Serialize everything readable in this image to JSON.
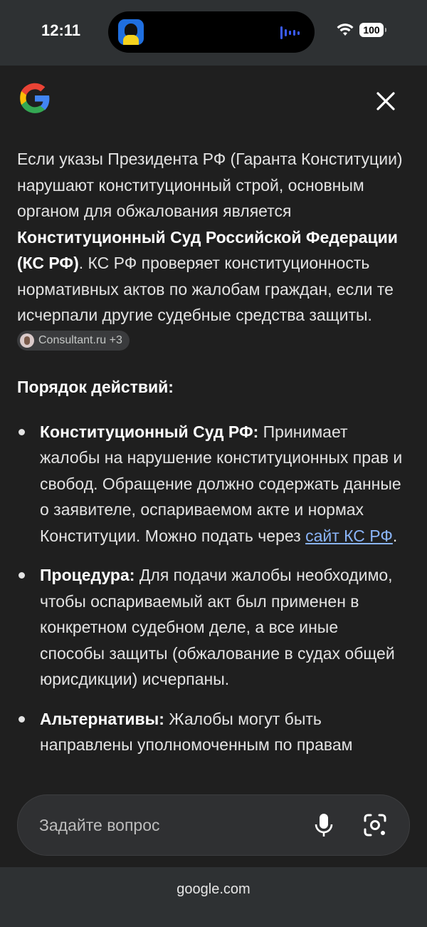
{
  "status_bar": {
    "time": "12:11",
    "battery": "100",
    "icons": [
      "app-icon",
      "audio-wave-icon",
      "wifi-icon",
      "battery-icon"
    ]
  },
  "panel": {
    "logo": "google-g-icon",
    "close_icon": "close-icon",
    "intro": {
      "part1": "Если указы Президента РФ (Гаранта Конституции) нарушают конституционный строй, основным органом для обжалования является ",
      "bold": "Конституционный Суд Российской Федерации (КС РФ)",
      "part2": ". КС РФ проверяет конституционность нормативных актов по жалобам граждан, если те исчерпали другие судебные средства защиты.",
      "source_chip": "Consultant.ru +3"
    },
    "heading": "Порядок действий:",
    "bullets": [
      {
        "title": "Конституционный Суд РФ:",
        "text": " Принимает жалобы на нарушение конституционных прав и свобод. Обращение должно содержать данные о заявителе, оспариваемом акте и нормах Конституции. Можно подать через ",
        "link": "сайт КС РФ",
        "end": "."
      },
      {
        "title": "Процедура:",
        "text": " Для подачи жалобы необходимо, чтобы оспариваемый акт был применен в конкретном судебном деле, а все иные способы защиты (обжалование в судах общей юрисдикции) исчерпаны."
      },
      {
        "title": "Альтернативы:",
        "text": " Жалобы могут быть направлены уполномоченным по правам"
      }
    ]
  },
  "ask_bar": {
    "placeholder": "Задайте вопрос",
    "mic_icon": "mic-icon",
    "lens_icon": "camera-lens-icon"
  },
  "browser": {
    "url": "google.com"
  },
  "colors": {
    "panel_bg": "#1f1f1f",
    "chrome_bg": "#2e3133",
    "link": "#8ab4f8",
    "text": "#e3e3e3"
  }
}
